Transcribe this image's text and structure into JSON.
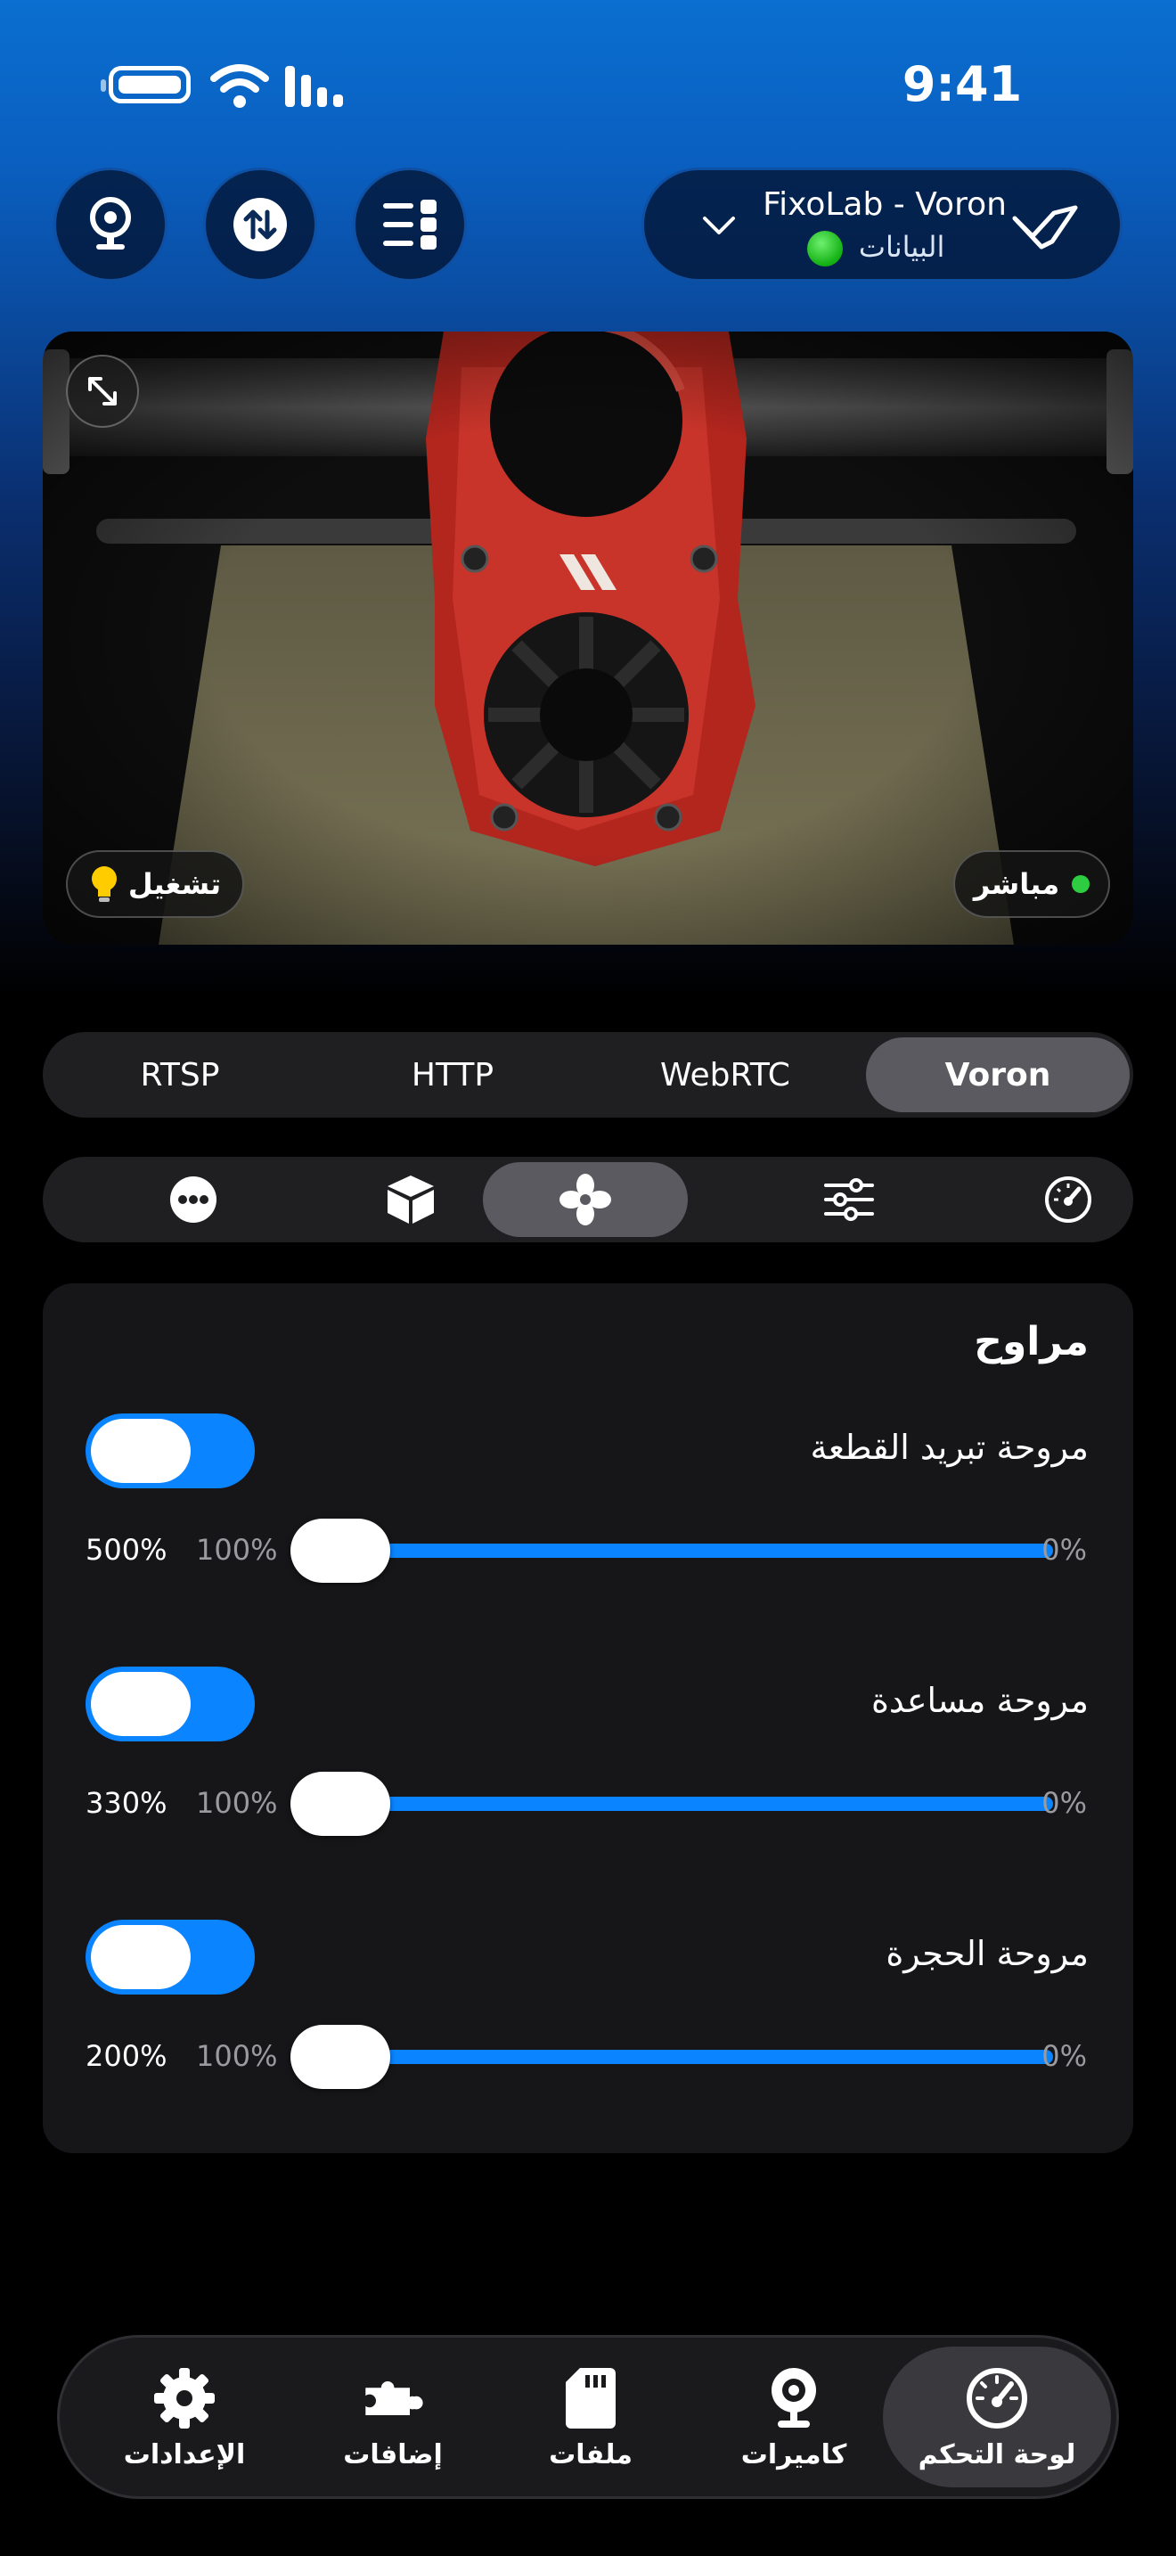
{
  "status_bar": {
    "time": "9:41"
  },
  "printer": {
    "name": "FixoLab - Voron",
    "status_text": "البيانات",
    "status_color": "#22c322"
  },
  "camera": {
    "live_label": "مباشر",
    "light_label": "تشغيل",
    "live_color": "#2ecc40"
  },
  "sources": [
    {
      "label": "RTSP"
    },
    {
      "label": "HTTP"
    },
    {
      "label": "WebRTC"
    },
    {
      "label": "Voron",
      "active": true
    }
  ],
  "tools": [
    {
      "icon": "more-icon"
    },
    {
      "icon": "cube-icon"
    },
    {
      "icon": "fan-icon",
      "active": true
    },
    {
      "icon": "sliders-icon"
    },
    {
      "icon": "gauge-icon"
    }
  ],
  "fans": {
    "title": "مراوح",
    "items": [
      {
        "label": "مروحة تبريد القطعة",
        "max": "500%",
        "current": "100%",
        "min": "0%",
        "enabled": true
      },
      {
        "label": "مروحة مساعدة",
        "max": "330%",
        "current": "100%",
        "min": "0%",
        "enabled": true
      },
      {
        "label": "مروحة الحجرة",
        "max": "200%",
        "current": "100%",
        "min": "0%",
        "enabled": true
      }
    ]
  },
  "tabs": [
    {
      "label": "الإعدادات",
      "icon": "gear-icon"
    },
    {
      "label": "إضافات",
      "icon": "puzzle-icon"
    },
    {
      "label": "ملفات",
      "icon": "sd-card-icon"
    },
    {
      "label": "كاميرات",
      "icon": "webcam-icon"
    },
    {
      "label": "لوحة التحكم",
      "icon": "dashboard-gauge-icon",
      "active": true
    }
  ],
  "colors": {
    "accent": "#0a84ff",
    "card": "#161618",
    "segment_active": "#5a5a60"
  }
}
